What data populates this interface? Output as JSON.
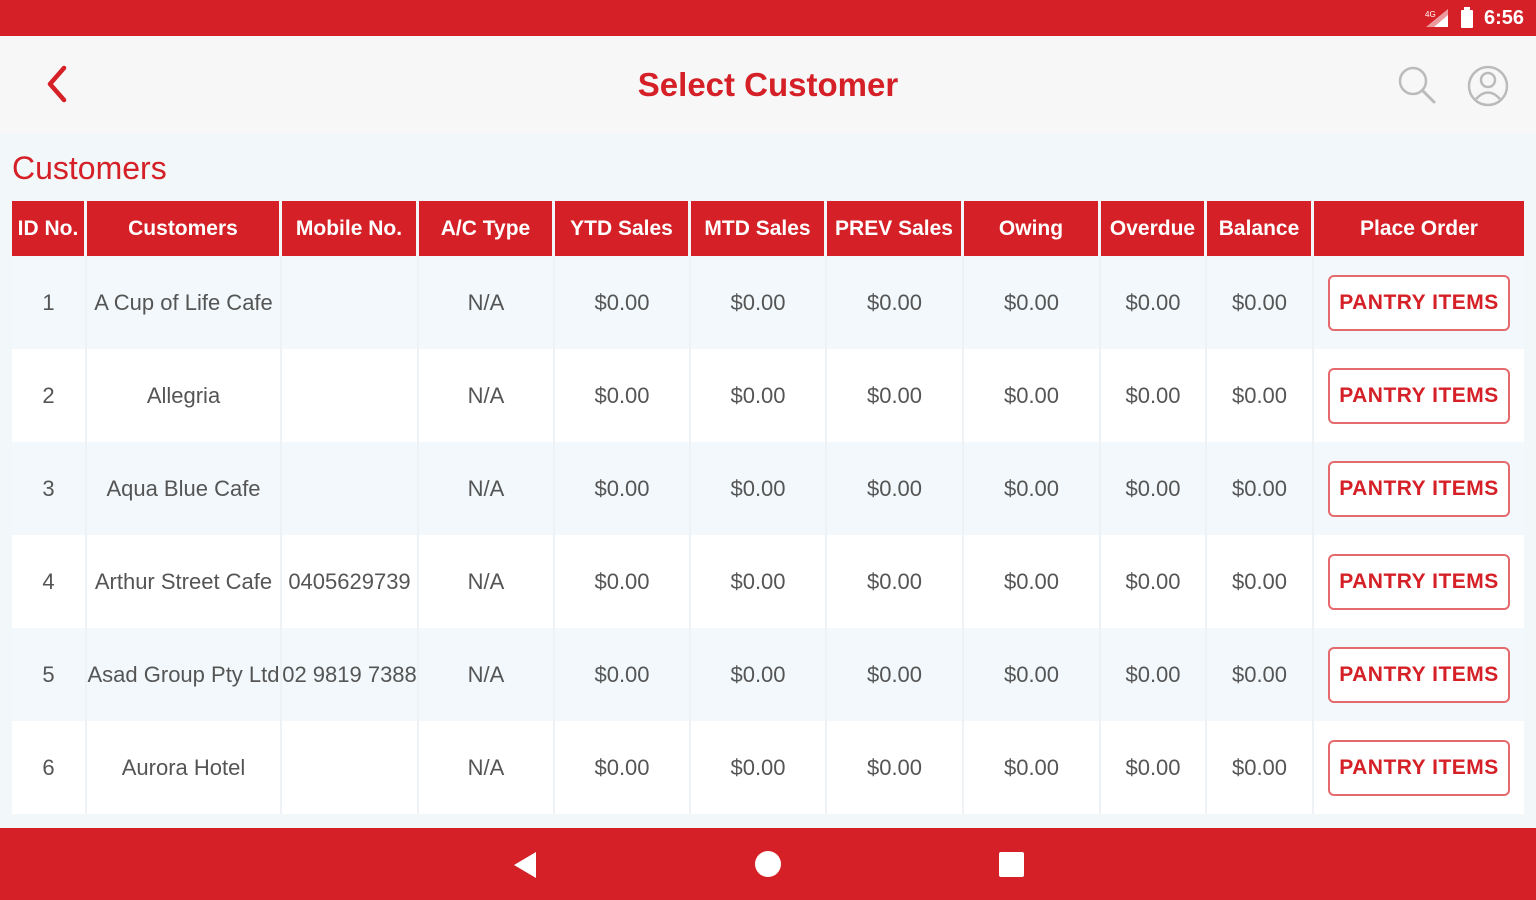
{
  "status_bar": {
    "time": "6:56",
    "icons": [
      "signal-icon",
      "battery-icon"
    ]
  },
  "header": {
    "title": "Select Customer",
    "back_icon": "chevron-left-icon",
    "search_icon": "search-icon",
    "profile_icon": "user-icon"
  },
  "section": {
    "title": "Customers"
  },
  "table": {
    "columns": [
      "ID No.",
      "Customers",
      "Mobile No.",
      "A/C Type",
      "YTD Sales",
      "MTD Sales",
      "PREV Sales",
      "Owing",
      "Overdue",
      "Balance",
      "Place Order"
    ],
    "rows": [
      {
        "id": "1",
        "customer": "A Cup of Life Cafe",
        "mobile": "",
        "ac_type": "N/A",
        "ytd": "$0.00",
        "mtd": "$0.00",
        "prev": "$0.00",
        "owing": "$0.00",
        "overdue": "$0.00",
        "balance": "$0.00",
        "action": "PANTRY ITEMS"
      },
      {
        "id": "2",
        "customer": "Allegria",
        "mobile": "",
        "ac_type": "N/A",
        "ytd": "$0.00",
        "mtd": "$0.00",
        "prev": "$0.00",
        "owing": "$0.00",
        "overdue": "$0.00",
        "balance": "$0.00",
        "action": "PANTRY ITEMS"
      },
      {
        "id": "3",
        "customer": "Aqua Blue Cafe",
        "mobile": "",
        "ac_type": "N/A",
        "ytd": "$0.00",
        "mtd": "$0.00",
        "prev": "$0.00",
        "owing": "$0.00",
        "overdue": "$0.00",
        "balance": "$0.00",
        "action": "PANTRY ITEMS"
      },
      {
        "id": "4",
        "customer": "Arthur Street Cafe",
        "mobile": "0405629739",
        "ac_type": "N/A",
        "ytd": "$0.00",
        "mtd": "$0.00",
        "prev": "$0.00",
        "owing": "$0.00",
        "overdue": "$0.00",
        "balance": "$0.00",
        "action": "PANTRY ITEMS"
      },
      {
        "id": "5",
        "customer": "Asad Group Pty Ltd",
        "mobile": "02 9819 7388",
        "ac_type": "N/A",
        "ytd": "$0.00",
        "mtd": "$0.00",
        "prev": "$0.00",
        "owing": "$0.00",
        "overdue": "$0.00",
        "balance": "$0.00",
        "action": "PANTRY ITEMS"
      },
      {
        "id": "6",
        "customer": "Aurora Hotel",
        "mobile": "",
        "ac_type": "N/A",
        "ytd": "$0.00",
        "mtd": "$0.00",
        "prev": "$0.00",
        "owing": "$0.00",
        "overdue": "$0.00",
        "balance": "$0.00",
        "action": "PANTRY ITEMS"
      }
    ]
  },
  "nav_bar": {
    "icons": [
      "nav-back-icon",
      "nav-home-icon",
      "nav-recent-icon"
    ]
  },
  "colors": {
    "primary": "#d42026",
    "row_alt": "#f2f8fb",
    "text": "#555555"
  }
}
